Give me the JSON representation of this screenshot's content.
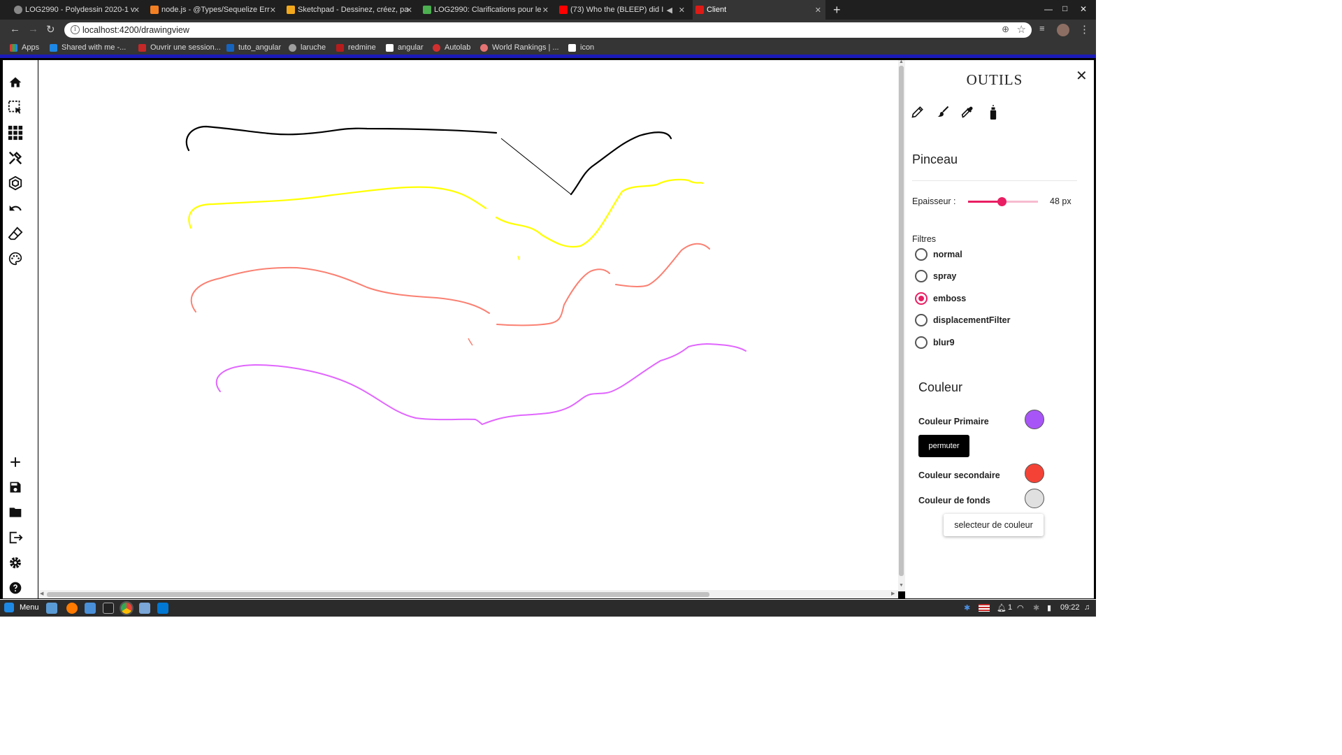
{
  "browser": {
    "tabs": [
      {
        "title": "LOG2990 - Polydessin 2020-1 v",
        "color": "#888888"
      },
      {
        "title": "node.js - @Types/Sequelize Err",
        "color": "#f48024"
      },
      {
        "title": "Sketchpad - Dessinez, créez, pa",
        "color": "#f2a81d"
      },
      {
        "title": "LOG2990: Clarifications pour le",
        "color": "#4caf50"
      },
      {
        "title": "(73) Who the (BLEEP) did I",
        "color": "#ff0000"
      },
      {
        "title": "Client",
        "color": "#dd1b16"
      }
    ],
    "url": "localhost:4200/drawingview",
    "bookmarks": [
      {
        "label": "Apps",
        "color": "#e53935"
      },
      {
        "label": "Shared with me -...",
        "color": "#1e88e5"
      },
      {
        "label": "Ouvrir une session...",
        "color": "#c62828"
      },
      {
        "label": "tuto_angular",
        "color": "#1565c0"
      },
      {
        "label": "laruche",
        "color": "#9e9e9e"
      },
      {
        "label": "redmine",
        "color": "#b71c1c"
      },
      {
        "label": "angular",
        "color": "#ffffff"
      },
      {
        "label": "Autolab",
        "color": "#d32f2f"
      },
      {
        "label": "World Rankings | ...",
        "color": "#e57373"
      },
      {
        "label": "icon",
        "color": "#ffffff"
      }
    ]
  },
  "left_toolbar": {
    "top": [
      "home-icon",
      "selection-icon",
      "grid-icon",
      "tools-icon",
      "polygon-icon",
      "undo-icon",
      "eraser-icon",
      "palette-icon"
    ],
    "bottom": [
      "add-icon",
      "save-icon",
      "folder-icon",
      "export-icon",
      "settings-icon",
      "help-icon"
    ]
  },
  "panel": {
    "title": "OUTILS",
    "tools": [
      "pencil-icon",
      "brush-icon",
      "pipette-icon",
      "spray-icon"
    ],
    "section_title": "Pinceau",
    "thickness_label": "Epaisseur :",
    "thickness_value": "48 px",
    "thickness_fraction": 0.48,
    "filters_label": "Filtres",
    "filters": [
      {
        "label": "normal",
        "selected": false
      },
      {
        "label": "spray",
        "selected": false
      },
      {
        "label": "emboss",
        "selected": true
      },
      {
        "label": "displacementFilter",
        "selected": false
      },
      {
        "label": "blur9",
        "selected": false
      }
    ],
    "color_title": "Couleur",
    "primary_label": "Couleur Primaire",
    "primary_color": "#a855f7",
    "swap_label": "permuter",
    "secondary_label": "Couleur secondaire",
    "secondary_color": "#f44336",
    "background_label": "Couleur de fonds",
    "background_color": "#e0e0e0",
    "picker_label": "selecteur de couleur"
  },
  "drawing": {
    "stroke_colors": [
      "#000000",
      "#ffff00",
      "#fa8072",
      "#e066ff"
    ]
  },
  "taskbar": {
    "menu_label": "Menu",
    "workspace": "1",
    "time": "09:22"
  }
}
